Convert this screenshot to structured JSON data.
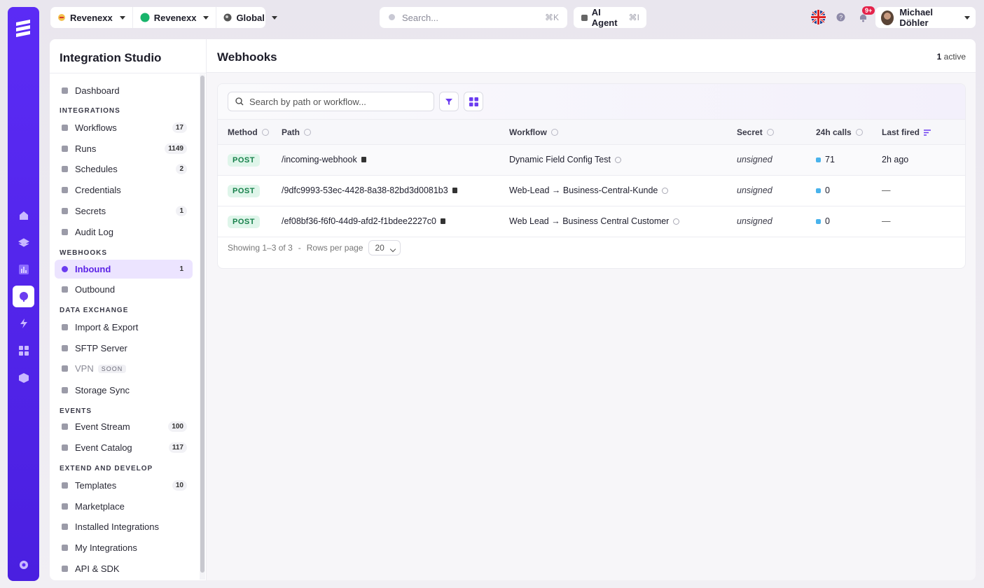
{
  "topbar": {
    "org1": "Revenexx",
    "org2": "Revenexx",
    "scope": "Global",
    "search_placeholder": "Search...",
    "search_shortcut": "⌘K",
    "agent_label": "AI Agent",
    "agent_shortcut": "⌘I",
    "notification_badge": "9+",
    "user_name": "Michael Döhler"
  },
  "sidebar": {
    "title": "Integration Studio",
    "dashboard": "Dashboard",
    "sections": {
      "integrations": "INTEGRATIONS",
      "webhooks": "WEBHOOKS",
      "data_exchange": "DATA EXCHANGE",
      "events": "EVENTS",
      "extend": "EXTEND AND DEVELOP"
    },
    "items": [
      {
        "label": "Workflows",
        "count": "17"
      },
      {
        "label": "Runs",
        "count": "1149"
      },
      {
        "label": "Schedules",
        "count": "2"
      },
      {
        "label": "Credentials",
        "count": ""
      },
      {
        "label": "Secrets",
        "count": "1"
      },
      {
        "label": "Audit Log",
        "count": ""
      },
      {
        "label": "Inbound",
        "count": "1"
      },
      {
        "label": "Outbound",
        "count": ""
      },
      {
        "label": "Import & Export",
        "count": ""
      },
      {
        "label": "SFTP Server",
        "count": ""
      },
      {
        "label": "VPN",
        "count": "",
        "tag": "SOON"
      },
      {
        "label": "Storage Sync",
        "count": ""
      },
      {
        "label": "Event Stream",
        "count": "100"
      },
      {
        "label": "Event Catalog",
        "count": "117"
      },
      {
        "label": "Templates",
        "count": "10"
      },
      {
        "label": "Marketplace",
        "count": ""
      },
      {
        "label": "Installed Integrations",
        "count": ""
      },
      {
        "label": "My Integrations",
        "count": ""
      },
      {
        "label": "API & SDK",
        "count": ""
      }
    ]
  },
  "main": {
    "title": "Webhooks",
    "active_count": "1",
    "active_label": "active",
    "search_placeholder": "Search by path or workflow...",
    "columns": [
      "Method",
      "Path",
      "Workflow",
      "Secret",
      "24h calls",
      "Last fired"
    ],
    "rows": [
      {
        "method": "POST",
        "path": "/incoming-webhook",
        "workflow": "Dynamic Field Config Test",
        "secret": "unsigned",
        "calls": "71",
        "last_fired": "2h ago"
      },
      {
        "method": "POST",
        "path": "/9dfc9993-53ec-4428-8a38-82bd3d0081b3",
        "workflow": "Web-Lead → Business-Central-Kunde",
        "secret": "unsigned",
        "calls": "0",
        "last_fired": "—"
      },
      {
        "method": "POST",
        "path": "/ef08bf36-f6f0-44d9-afd2-f1bdee2227c0",
        "workflow": "Web Lead → Business Central Customer",
        "secret": "unsigned",
        "calls": "0",
        "last_fired": "—"
      }
    ],
    "footer": {
      "showing": "Showing 1–3 of 3",
      "separator": "-",
      "rows_per_page_label": "Rows per page",
      "rows_per_page_value": "20"
    }
  },
  "colors": {
    "accent": "#5b2bf5",
    "post_badge_bg": "#dff5ea",
    "post_badge_text": "#16804a",
    "calls_indicator": "#49b3ec",
    "notification": "#e5224a"
  }
}
